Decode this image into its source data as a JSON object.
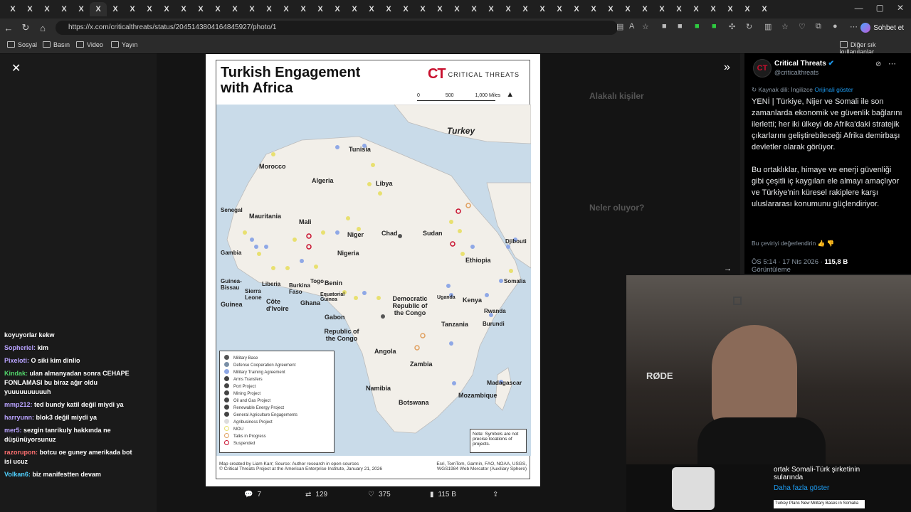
{
  "browser": {
    "url": "https://x.com/criticalthreats/status/2045143804164845927/photo/1",
    "bookmarks": [
      "Sosyal",
      "Basın",
      "Video",
      "Yayın"
    ],
    "other_bookmarks": "Diğer sık kullanılanlar",
    "chat_button": "Sohbet et",
    "tab_letters": [
      "X",
      "X",
      "X",
      "X",
      "X",
      "X",
      "X",
      "X",
      "X",
      "X",
      "X",
      "X",
      "X",
      "X",
      "X",
      "X",
      "X",
      "X",
      "X",
      "X",
      "X",
      "X",
      "X",
      "X",
      "X",
      "X",
      "X",
      "X",
      "X",
      "X",
      "X",
      "X",
      "X",
      "X",
      "X",
      "X",
      "X",
      "X",
      "X",
      "X",
      "X",
      "X",
      "X",
      "X",
      "X"
    ]
  },
  "map": {
    "title_line1": "Turkish Engagement",
    "title_line2": "with Africa",
    "brand_logo": "CT",
    "brand_name": "CRITICAL THREATS",
    "scale": {
      "zero": "0",
      "mid": "500",
      "max": "1,000 Miles"
    },
    "north": "N",
    "labels": {
      "turkey": "Turkey",
      "tunisia": "Tunisia",
      "morocco": "Morocco",
      "algeria": "Algeria",
      "libya": "Libya",
      "senegal": "Senegal",
      "mauritania": "Mauritania",
      "mali": "Mali",
      "niger": "Niger",
      "chad": "Chad",
      "sudan": "Sudan",
      "djibouti": "Djibouti",
      "gambia": "Gambia",
      "nigeria": "Nigeria",
      "ethiopia": "Ethiopia",
      "guinea_bissau": "Guinea-Bissau",
      "sierra_leone": "Sierra Leone",
      "liberia": "Liberia",
      "burkina": "Burkina Faso",
      "togo": "Togo",
      "benin": "Benin",
      "somalia": "Somalia",
      "guinea": "Guinea",
      "cote": "Côte d'Ivoire",
      "ghana": "Ghana",
      "eq_guinea": "Equatorial Guinea",
      "drc": "Democratic Republic of the Congo",
      "uganda": "Uganda",
      "kenya": "Kenya",
      "gabon": "Gabon",
      "rwanda": "Rwanda",
      "burundi": "Burundi",
      "tanzania": "Tanzania",
      "roc": "Republic of the Congo",
      "angola": "Angola",
      "zambia": "Zambia",
      "madagascar": "Madagascar",
      "namibia": "Namibia",
      "mozambique": "Mozambique",
      "botswana": "Botswana"
    },
    "legend": [
      {
        "label": "Military Base",
        "color": "#555555"
      },
      {
        "label": "Defense Cooperation Agreement",
        "color": "#7a8fa6"
      },
      {
        "label": "Military Training Agreement",
        "color": "#8fa8e6"
      },
      {
        "label": "Arms Transfers",
        "color": "#444444"
      },
      {
        "label": "Port Project",
        "color": "#444444"
      },
      {
        "label": "Mining Project",
        "color": "#444444"
      },
      {
        "label": "Oil and Gas Project",
        "color": "#444444"
      },
      {
        "label": "Renewable Energy Project",
        "color": "#444444"
      },
      {
        "label": "General Agriculture Engagements",
        "color": "#444444"
      },
      {
        "label": "Agribusiness Project",
        "color": "#dddddd"
      },
      {
        "label": "MOU",
        "color": "#e8e070"
      },
      {
        "label": "Talks in Progress",
        "color": "#e0a060"
      },
      {
        "label": "Suspended",
        "color": "#c8102e"
      }
    ],
    "note": "Note: Symbols are not precise locations of projects.",
    "credit_line1": "Map created by Liam Karr; Source: Author research in open sources",
    "credit_line2": "© Critical Threats Project at the American Enterprise Institute, January 21, 2026",
    "credit_right1": "Esri, TomTom, Garmin, FAO, NOAA, USGS,",
    "credit_right2": "WGS1984 Web Mercator (Auxiliary Sphere)"
  },
  "actions": {
    "replies": "7",
    "reposts": "129",
    "likes": "375",
    "views": "115 B"
  },
  "tweet": {
    "author": "Critical Threats",
    "handle": "@criticalthreats",
    "avatar": "CT",
    "source_lang": "Kaynak dili: İngilizce",
    "show_original": "Orijinali göster",
    "para1": "YENİ | Türkiye, Nijer ve Somali ile son zamanlarda ekonomik ve güvenlik bağlarını ilerletti; her iki ülkeyi de Afrika'daki stratejik çıkarlarını geliştirebileceği Afrika demirbaşı devletler olarak görüyor.",
    "para2": "Bu ortaklıklar, himaye ve enerji güvenliği gibi çeşitli iç kaygıları ele almayı amaçlıyor ve Türkiye'nin küresel rakiplere karşı uluslararası konumunu güçlendiriyor.",
    "rate": "Bu çeviriyi değerlendirin",
    "meta_time": "ÖS 5:14 · 17 Nis 2026 ·",
    "meta_views": "115,8 B",
    "meta_suffix": "Görüntüleme"
  },
  "bg_right": {
    "related": "Alakalı kişiler",
    "happening": "Neler oluyor?"
  },
  "camera": {
    "mic_brand": "RØDE"
  },
  "promo": {
    "text": "ortak Somali-Türk şirketinin sularında",
    "more": "Daha fazla göster",
    "thumb": "Turkey Plans New Military Bases in Somalia"
  },
  "chat": [
    {
      "user": "",
      "msg": "koyuyorlar kekw",
      "color": "#ffffff"
    },
    {
      "user": "Sopheriel:",
      "msg": "kim",
      "color": "#b9a3ff"
    },
    {
      "user": "Pixeloti:",
      "msg": "O siki kim dinlio",
      "color": "#b9a3ff"
    },
    {
      "user": "Kindak:",
      "msg": "ulan almanyadan sonra CEHAPE FONLAMASI bu biraz ağır oldu yuuuuuuuuuuh",
      "color": "#52d36a"
    },
    {
      "user": "mmp212:",
      "msg": "ted bundy katil değil miydi ya",
      "color": "#b9a3ff"
    },
    {
      "user": "harryunn:",
      "msg": "blok3 değil miydi ya",
      "color": "#b9a3ff"
    },
    {
      "user": "mer5:",
      "msg": "sezgin tanrikuly hakkında ne düşünüyorsunuz",
      "color": "#b9a3ff"
    },
    {
      "user": "razorupon:",
      "msg": "botcu oe guney amerikada bot isi ucuz",
      "color": "#ff7070"
    },
    {
      "user": "Volkan6:",
      "msg": "biz manifestten devam",
      "color": "#4fd0ff"
    }
  ]
}
